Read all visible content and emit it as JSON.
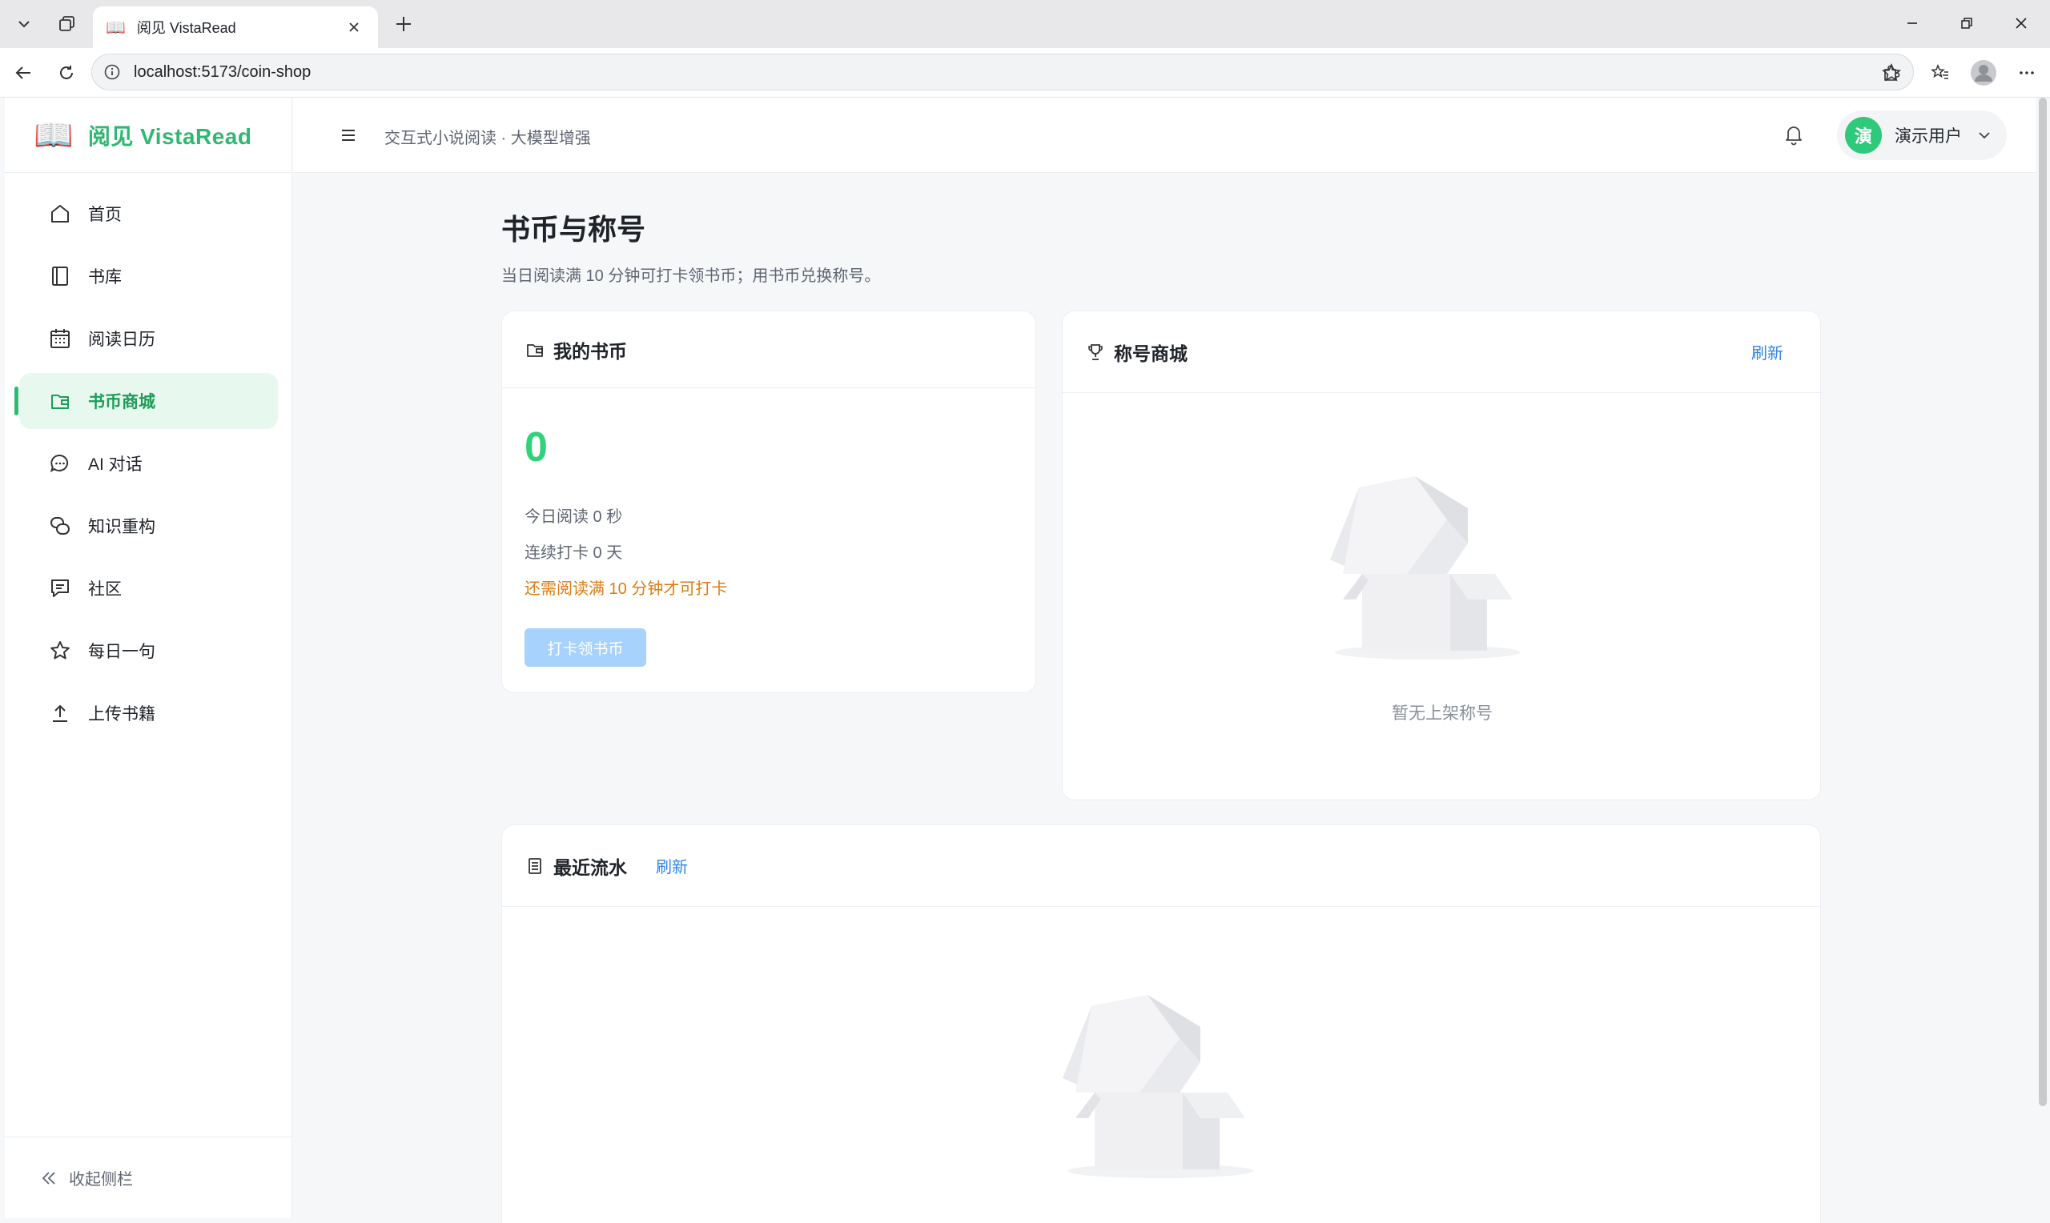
{
  "browser": {
    "tab_title": "阅见 VistaRead",
    "tab_favicon": "📖",
    "url": "localhost:5173/coin-shop"
  },
  "app": {
    "logo_emoji": "📖",
    "brand_name": "阅见 VistaRead",
    "header_subtitle": "交互式小说阅读 · 大模型增强",
    "user": {
      "avatar_text": "演",
      "name": "演示用户"
    },
    "accent_color": "#2fb871"
  },
  "sidebar": {
    "items": [
      {
        "label": "首页",
        "icon": "home-icon"
      },
      {
        "label": "书库",
        "icon": "book-icon"
      },
      {
        "label": "阅读日历",
        "icon": "calendar-icon"
      },
      {
        "label": "书币商城",
        "icon": "wallet-icon",
        "active": true
      },
      {
        "label": "AI 对话",
        "icon": "chat-icon"
      },
      {
        "label": "知识重构",
        "icon": "knowledge-icon"
      },
      {
        "label": "社区",
        "icon": "community-icon"
      },
      {
        "label": "每日一句",
        "icon": "star-icon"
      },
      {
        "label": "上传书籍",
        "icon": "upload-icon"
      }
    ],
    "collapse_label": "收起侧栏"
  },
  "page": {
    "title": "书币与称号",
    "description": "当日阅读满 10 分钟可打卡领书币；用书币兑换称号。"
  },
  "wallet_card": {
    "title": "我的书币",
    "coins": "0",
    "today_reading": "今日阅读 0 秒",
    "streak": "连续打卡 0 天",
    "hint": "还需阅读满 10 分钟才可打卡",
    "checkin_button": "打卡领书币"
  },
  "shop_card": {
    "title": "称号商城",
    "refresh": "刷新",
    "empty_text": "暂无上架称号"
  },
  "history_card": {
    "title": "最近流水",
    "refresh": "刷新"
  }
}
